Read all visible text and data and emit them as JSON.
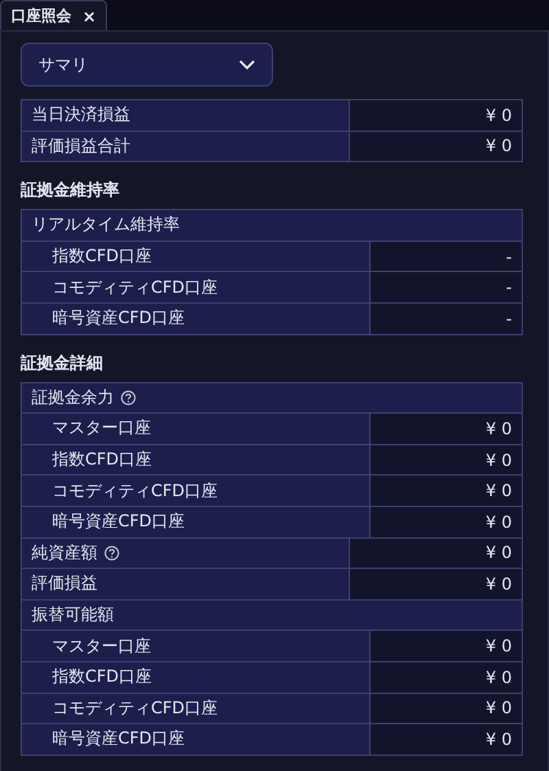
{
  "tabs": [
    {
      "label": "口座照会",
      "close": "×",
      "selected": true
    }
  ],
  "dropdown": {
    "value": "サマリ"
  },
  "sections": [
    {
      "rows": [
        {
          "kind": "row",
          "label": "当日決済損益",
          "value": "¥ 0"
        },
        {
          "kind": "row",
          "label": "評価損益合計",
          "value": "¥ 0"
        }
      ]
    },
    {
      "title": "証拠金維持率",
      "rows": [
        {
          "kind": "header",
          "label": "リアルタイム維持率"
        },
        {
          "kind": "sub",
          "label": "指数CFD口座",
          "value": "-"
        },
        {
          "kind": "sub",
          "label": "コモディティCFD口座",
          "value": "-"
        },
        {
          "kind": "sub",
          "label": "暗号資産CFD口座",
          "value": "-"
        }
      ]
    },
    {
      "title": "証拠金詳細",
      "rows": [
        {
          "kind": "header",
          "label": "証拠金余力",
          "help": true
        },
        {
          "kind": "sub",
          "label": "マスター口座",
          "value": "¥ 0"
        },
        {
          "kind": "sub",
          "label": "指数CFD口座",
          "value": "¥ 0"
        },
        {
          "kind": "sub",
          "label": "コモディティCFD口座",
          "value": "¥ 0"
        },
        {
          "kind": "sub",
          "label": "暗号資産CFD口座",
          "value": "¥ 0"
        },
        {
          "kind": "row",
          "label": "純資産額",
          "value": "¥ 0",
          "help": true
        },
        {
          "kind": "row",
          "label": "評価損益",
          "value": "¥ 0"
        },
        {
          "kind": "header",
          "label": "振替可能額"
        },
        {
          "kind": "sub",
          "label": "マスター口座",
          "value": "¥ 0"
        },
        {
          "kind": "sub",
          "label": "指数CFD口座",
          "value": "¥ 0"
        },
        {
          "kind": "sub",
          "label": "コモディティCFD口座",
          "value": "¥ 0"
        },
        {
          "kind": "sub",
          "label": "暗号資産CFD口座",
          "value": "¥ 0"
        }
      ]
    }
  ]
}
